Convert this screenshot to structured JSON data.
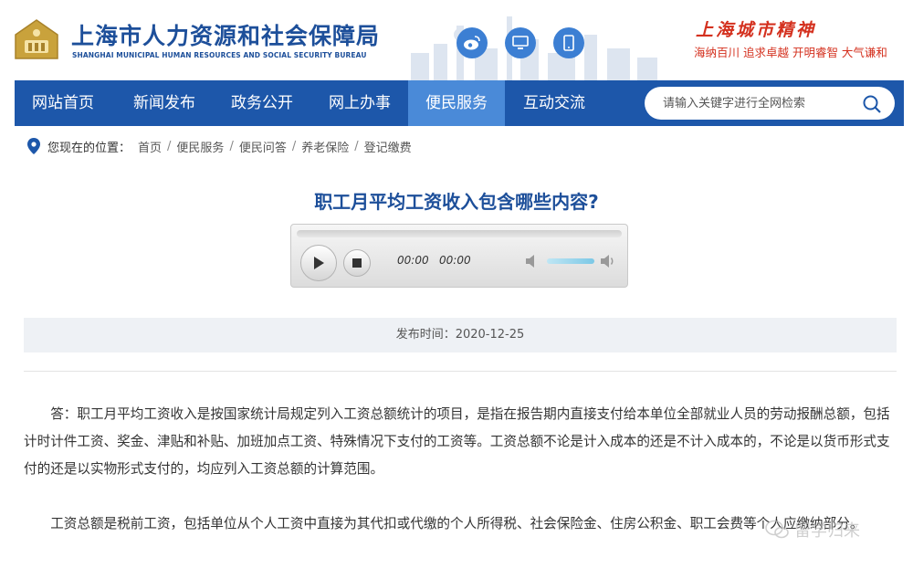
{
  "header": {
    "title_cn": "上海市人力资源和社会保障局",
    "title_en": "SHANGHAI MUNICIPAL HUMAN RESOURCES AND SOCIAL SECURITY BUREAU",
    "spirit_title": "上海城市精神",
    "spirit_slogan": "海纳百川 追求卓越 开明睿智 大气谦和",
    "icons": [
      "weibo-icon",
      "pc-icon",
      "mobile-icon"
    ]
  },
  "nav": {
    "items": [
      {
        "label": "网站首页"
      },
      {
        "label": "新闻发布"
      },
      {
        "label": "政务公开"
      },
      {
        "label": "网上办事"
      },
      {
        "label": "便民服务"
      },
      {
        "label": "互动交流"
      }
    ],
    "active": "便民服务",
    "search_placeholder": "请输入关键字进行全网检索"
  },
  "breadcrumb": {
    "label": "您现在的位置：",
    "items": [
      "首页",
      "便民服务",
      "便民问答",
      "养老保险",
      "登记缴费"
    ]
  },
  "article": {
    "title": "职工月平均工资收入包含哪些内容?",
    "audio": {
      "current": "00:00",
      "total": "00:00"
    },
    "pubdate": "发布时间：2020-12-25",
    "para1": "答：职工月平均工资收入是按国家统计局规定列入工资总额统计的项目，是指在报告期内直接支付给本单位全部就业人员的劳动报酬总额，包括计时计件工资、奖金、津贴和补贴、加班加点工资、特殊情况下支付的工资等。工资总额不论是计入成本的还是不计入成本的，不论是以货币形式支付的还是以实物形式支付的，均应列入工资总额的计算范围。",
    "para2": "工资总额是税前工资，包括单位从个人工资中直接为其代扣或代缴的个人所得税、社会保险金、住房公积金、职工会费等个人应缴纳部分。"
  },
  "watermark": "留学归来",
  "colors": {
    "brand": "#1d57aa",
    "active_nav": "#4a8ad8",
    "slogan": "#d4301e"
  }
}
